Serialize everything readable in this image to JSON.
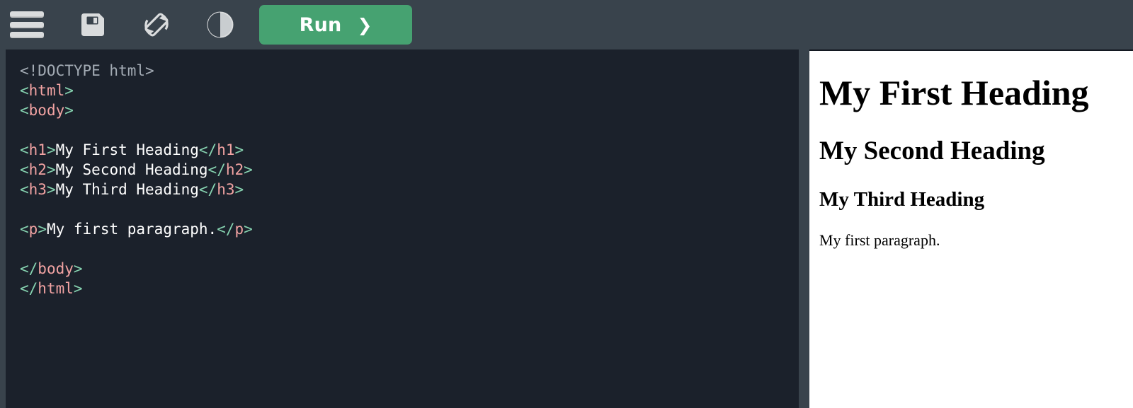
{
  "toolbar": {
    "menu_icon": "hamburger-menu-icon",
    "save_icon": "floppy-disk-save-icon",
    "rotate_icon": "screen-rotation-icon",
    "contrast_icon": "contrast-theme-icon",
    "run_label": "Run",
    "run_chevron": "❯",
    "background_color": "#39434c",
    "run_button_color": "#46a271",
    "icon_color": "#dadcdd"
  },
  "editor": {
    "background_color": "#1b212b",
    "syntax_colors": {
      "punctuation": "#86d3b0",
      "tag": "#f2a3a3",
      "text": "#ffffff",
      "doctype": "#a3abb4"
    },
    "lines": [
      {
        "type": "doctype",
        "text": "<!DOCTYPE html>"
      },
      {
        "type": "open_tag",
        "tag": "html"
      },
      {
        "type": "open_tag",
        "tag": "body"
      },
      {
        "type": "blank",
        "text": ""
      },
      {
        "type": "element",
        "tag": "h1",
        "text": "My First Heading"
      },
      {
        "type": "element",
        "tag": "h2",
        "text": "My Second Heading"
      },
      {
        "type": "element",
        "tag": "h3",
        "text": "My Third Heading"
      },
      {
        "type": "blank",
        "text": ""
      },
      {
        "type": "element",
        "tag": "p",
        "text": "My first paragraph."
      },
      {
        "type": "blank",
        "text": ""
      },
      {
        "type": "close_tag",
        "tag": "body"
      },
      {
        "type": "close_tag",
        "tag": "html"
      }
    ]
  },
  "preview": {
    "background_color": "#ffffff",
    "h1": "My First Heading",
    "h2": "My Second Heading",
    "h3": "My Third Heading",
    "paragraph": "My first paragraph."
  }
}
